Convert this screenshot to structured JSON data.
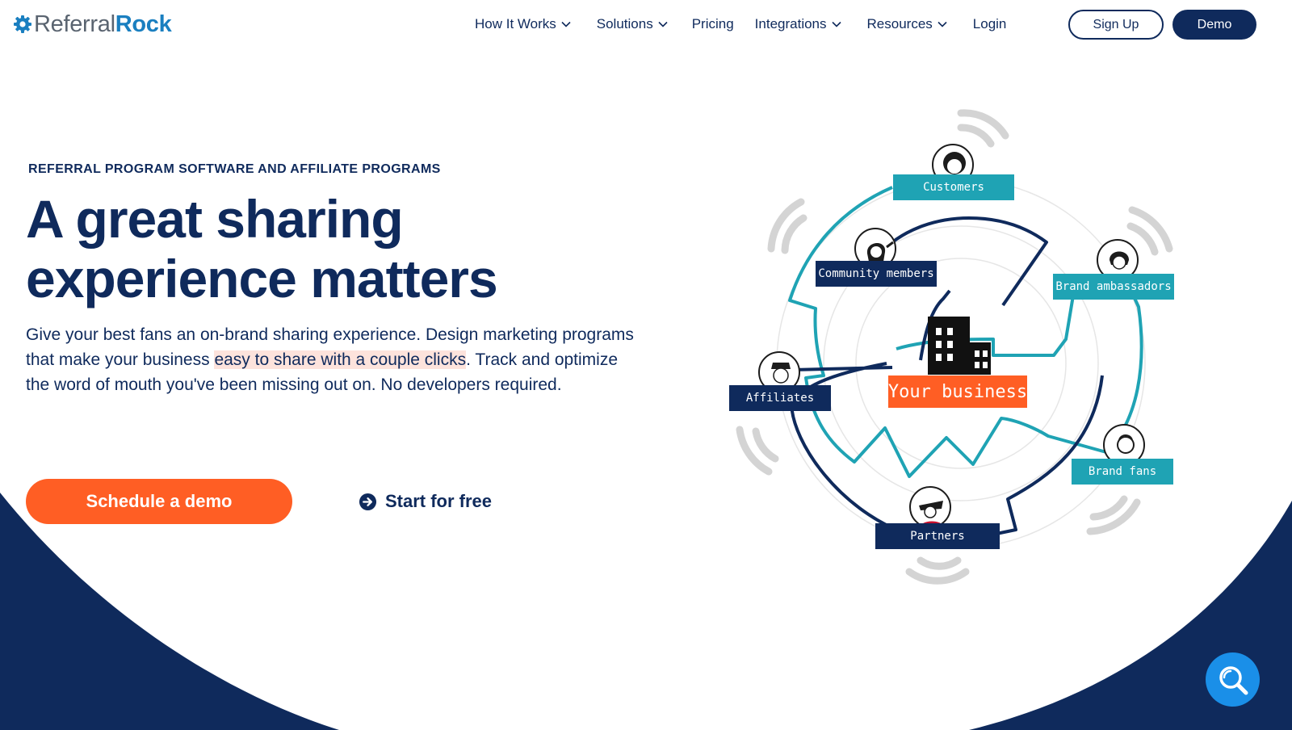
{
  "brand": {
    "name_part_a": "Referral",
    "name_part_b": "Rock",
    "colors": {
      "navy": "#0f2a5c",
      "orange": "#ff5e24",
      "teal": "#1fa3b4",
      "logo_blue": "#1a7fc0",
      "fab_blue": "#1a8fe8",
      "highlight": "#fde3dc"
    },
    "logo_icon": "gear-logo-icon"
  },
  "nav": {
    "items": [
      {
        "label": "How It Works",
        "has_dropdown": true
      },
      {
        "label": "Solutions",
        "has_dropdown": true
      },
      {
        "label": "Pricing",
        "has_dropdown": false
      },
      {
        "label": "Integrations",
        "has_dropdown": true
      },
      {
        "label": "Resources",
        "has_dropdown": true
      },
      {
        "label": "Login",
        "has_dropdown": false
      }
    ],
    "signup_label": "Sign Up",
    "demo_label": "Demo"
  },
  "hero": {
    "eyebrow": "REFERRAL PROGRAM SOFTWARE AND AFFILIATE PROGRAMS",
    "headline_line1": "A great sharing",
    "headline_line2": "experience matters",
    "body_before": "Give your best fans an on-brand sharing experience. Design marketing programs that make your business ",
    "body_highlight": "easy to share with a couple clicks",
    "body_after": ". Track and optimize the word of mouth you've been missing out on. No developers required.",
    "cta_primary": "Schedule a demo",
    "cta_secondary": "Start for free",
    "cta_secondary_icon": "arrow-circle-right-icon"
  },
  "diagram": {
    "center_label": "Your business",
    "center_icon": "building-icon",
    "nodes": [
      {
        "label": "Customers",
        "style": "teal"
      },
      {
        "label": "Community members",
        "style": "navy"
      },
      {
        "label": "Brand ambassadors",
        "style": "teal"
      },
      {
        "label": "Affiliates",
        "style": "navy"
      },
      {
        "label": "Brand fans",
        "style": "teal"
      },
      {
        "label": "Partners",
        "style": "navy"
      }
    ]
  },
  "fab": {
    "icon": "search-icon"
  }
}
